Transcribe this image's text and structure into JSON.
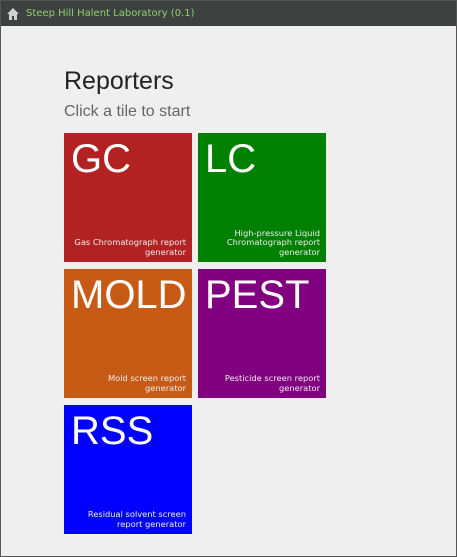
{
  "window": {
    "title": "Steep Hill Halent Laboratory (0.1)",
    "icon": "home-icon"
  },
  "page": {
    "title": "Reporters",
    "subtitle": "Click a tile to start"
  },
  "tiles": [
    {
      "label": "GC",
      "description": "Gas Chromatograph report generator",
      "color": "#b22222"
    },
    {
      "label": "LC",
      "description": "High-pressure Liquid Chromatograph report generator",
      "color": "#008000"
    },
    {
      "label": "MOLD",
      "description": "Mold screen report generator",
      "color": "#c75b16"
    },
    {
      "label": "PEST",
      "description": "Pesticide screen report generator",
      "color": "#800080"
    },
    {
      "label": "RSS",
      "description": "Residual solvent screen report generator",
      "color": "#0000ff"
    }
  ]
}
